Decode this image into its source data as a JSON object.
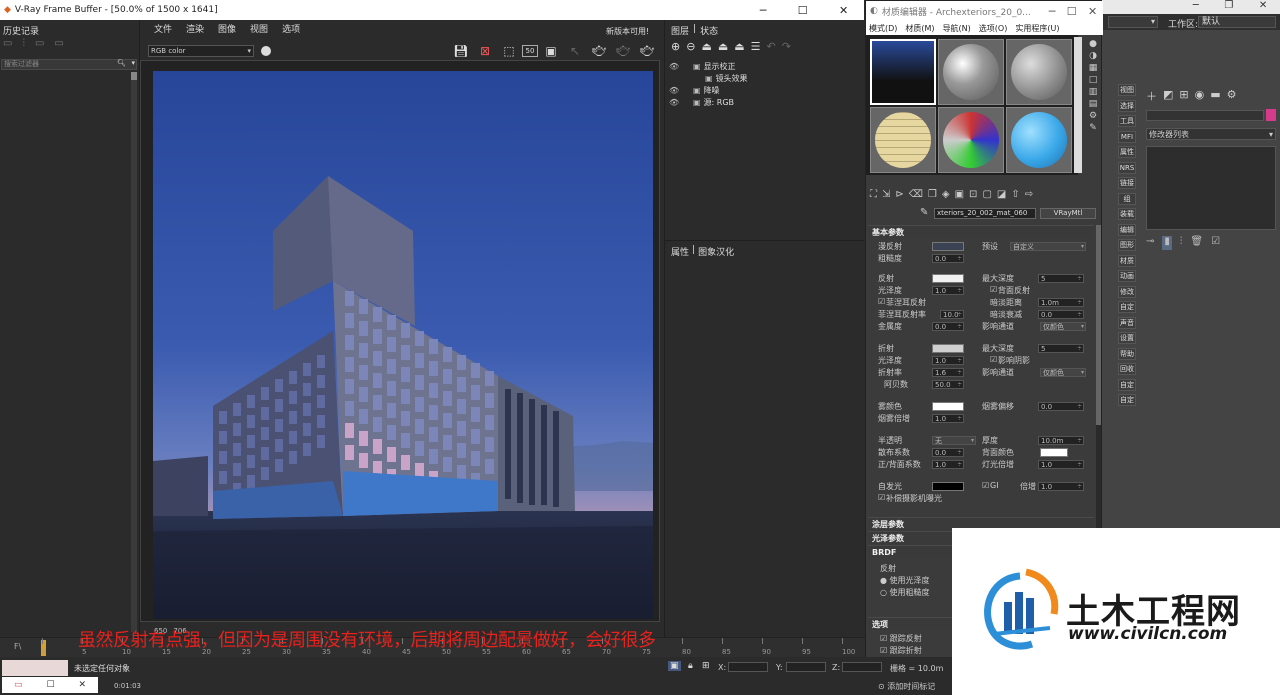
{
  "vfb": {
    "title": "V-Ray Frame Buffer - [50.0% of 1500 x 1641]",
    "history_title": "历史记录",
    "history_filter_placeholder": "搜索过滤器",
    "menu": [
      "文件",
      "渲染",
      "图像",
      "视图",
      "选项"
    ],
    "update_notice": "新版本可用!",
    "channel": "RGB color",
    "tab_layers": "图层",
    "tab_stats": "状态",
    "layers": [
      "显示校正",
      "镜头效果",
      "降噪",
      "源: RGB"
    ],
    "props_title": "属性",
    "props_tab2": "图象汉化",
    "zoom_x": "650",
    "zoom_y": "706",
    "btn_50": "50"
  },
  "mat_editor": {
    "title": "材质编辑器 - Archexteriors_20_0...",
    "menu": [
      "模式(D)",
      "材质(M)",
      "导航(N)",
      "选项(O)",
      "实用程序(U)"
    ],
    "mat_name": "xteriors_20_002_mat_060",
    "mat_type": "VRayMtl",
    "sections": {
      "basic": "基本参数",
      "coat": "涂层参数",
      "sheen": "光泽参数",
      "brdf": "BRDF",
      "options": "选项"
    },
    "params": {
      "diffuse": "漫反射",
      "preset": "预设",
      "preset_val": "自定义",
      "roughness": "粗糙度",
      "roughness_val": "0.0",
      "reflect": "反射",
      "max_depth": "最大深度",
      "max_depth_val": "5",
      "gloss": "光泽度",
      "gloss_val": "1.0",
      "back_reflect": "背面反射",
      "fresnel": "菲涅耳反射",
      "dim_dist": "暗淡距离",
      "dim_dist_val": "1.0m",
      "fresnel_ior": "菲涅耳反射率",
      "fresnel_ior_val": "10.0",
      "dim_falloff": "暗淡衰减",
      "dim_falloff_val": "0.0",
      "metal": "金属度",
      "metal_val": "0.0",
      "affect_ch": "影响通道",
      "affect_ch_val": "仅颜色",
      "refract": "折射",
      "max_depth2": "最大深度",
      "max_depth2_val": "5",
      "gloss2": "光泽度",
      "gloss2_val": "1.0",
      "affect_shadow": "影响阴影",
      "ior": "折射率",
      "ior_val": "1.6",
      "affect_ch2": "影响通道",
      "affect_ch2_val": "仅颜色",
      "abbe": "阿贝数",
      "abbe_val": "50.0",
      "fog": "雾颜色",
      "fog_bias": "烟雾偏移",
      "fog_bias_val": "0.0",
      "fog_mult": "烟雾倍增",
      "fog_mult_val": "1.0",
      "translucency": "半透明",
      "translucency_val": "无",
      "thickness": "厚度",
      "thickness_val": "10.0m",
      "scatter": "散布系数",
      "scatter_val": "0.0",
      "back_color": "背面颜色",
      "fb": "正/背面系数",
      "fb_val": "1.0",
      "light_mult": "灯光倍增",
      "light_mult_val": "1.0",
      "self_illum": "自发光",
      "gi": "GI",
      "mult": "倍增",
      "mult_val": "1.0",
      "comp_exp": "补偿摄影机曝光",
      "brdf_reflect": "反射",
      "use_gloss": "使用光泽度",
      "use_rough": "使用粗糙度",
      "trace_reflect": "跟踪反射",
      "trace_refract": "跟踪折射"
    }
  },
  "max": {
    "workspace_label": "工作区:",
    "workspace_val": "默认",
    "modifier_list": "修改器列表",
    "side_labels": [
      "视图",
      "选择",
      "工具",
      "MFI",
      "属性",
      "NRS",
      "链接",
      "组",
      "装载",
      "编辑",
      "图形",
      "材质",
      "动画",
      "修改",
      "自定",
      "声音",
      "设置",
      "帮助",
      "回收",
      "自定",
      "自定"
    ],
    "status_none": "未选定任何对象",
    "time": "0:01:03",
    "grid": "栅格 = 10.0m",
    "add_time_tag": "添加时间标记",
    "ticks": [
      "0",
      "5",
      "10",
      "15",
      "20",
      "25",
      "30",
      "35",
      "40",
      "45",
      "50",
      "55",
      "60",
      "65",
      "70",
      "75",
      "80",
      "85",
      "90",
      "95",
      "100"
    ],
    "coord_x": "X:",
    "coord_y": "Y:",
    "coord_z": "Z:"
  },
  "caption": "虽然反射有点强，但因为是周围没有环境，后期将周边配景做好，会好很多",
  "watermark": {
    "brand": "土木工程网",
    "url": "www.civilcn.com"
  },
  "colors": {
    "caption": "#e8211c",
    "sky_top": "#2a48a0",
    "accent_pink": "#d63a8a"
  }
}
